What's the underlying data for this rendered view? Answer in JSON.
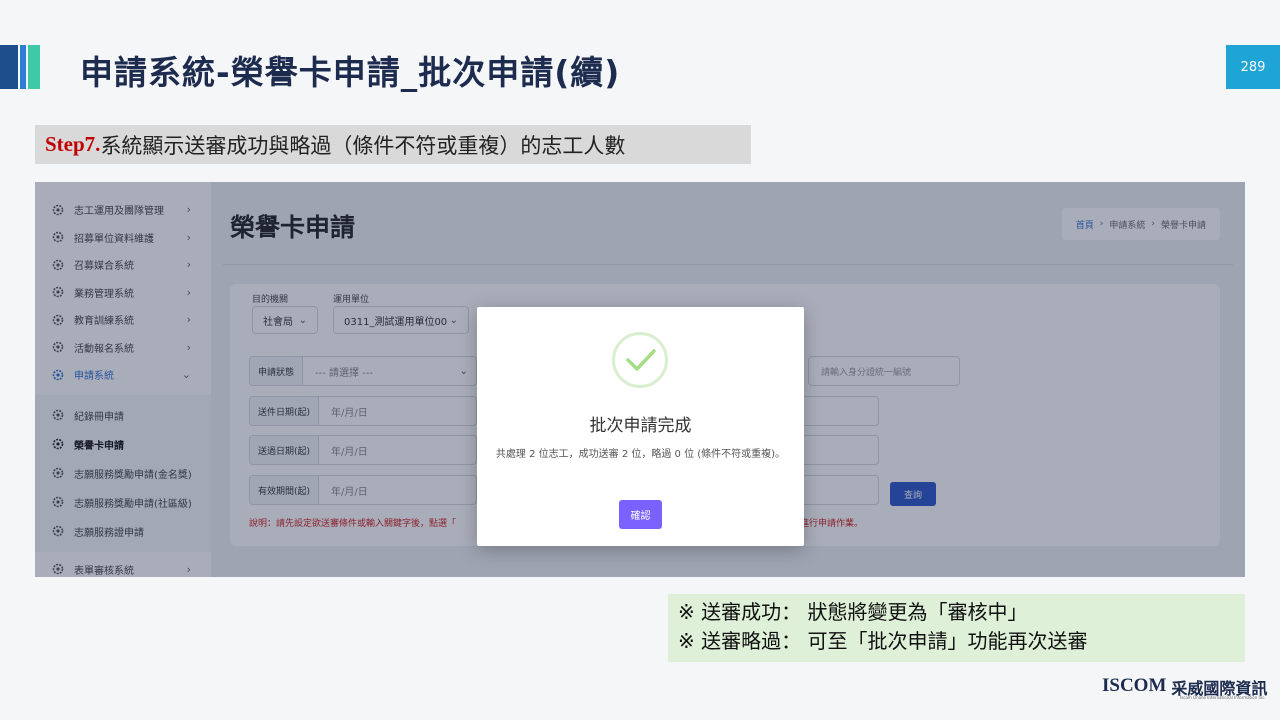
{
  "slide": {
    "title": "申請系統-榮譽卡申請_批次申請(續)",
    "page_number": "289",
    "step_label": "Step7.",
    "step_text": "系統顯示送審成功與略過（條件不符或重複）的志工人數"
  },
  "sidebar": {
    "items": [
      {
        "label": "志工運用及團隊管理",
        "chevron": "›"
      },
      {
        "label": "招募單位資料維護",
        "chevron": "›"
      },
      {
        "label": "召募媒合系統",
        "chevron": "›"
      },
      {
        "label": "業務管理系統",
        "chevron": "›"
      },
      {
        "label": "教育訓練系統",
        "chevron": "›"
      },
      {
        "label": "活動報名系統",
        "chevron": "›"
      },
      {
        "label": "申請系統",
        "chevron": "⌄"
      }
    ],
    "sub_items": [
      {
        "label": "紀錄冊申請"
      },
      {
        "label": "榮譽卡申請"
      },
      {
        "label": "志願服務獎勵申請(金名獎)"
      },
      {
        "label": "志願服務獎勵申請(社區級)"
      },
      {
        "label": "志願服務證申請"
      }
    ],
    "bottom_item": {
      "label": "表單審核系統",
      "chevron": "›"
    }
  },
  "main": {
    "page_title": "榮譽卡申請",
    "breadcrumb": {
      "home": "首頁",
      "sep1": "›",
      "mid": "申請系統",
      "sep2": "›",
      "current": "榮譽卡申請"
    },
    "filters": {
      "category_label": "目的機關",
      "category_value": "社會局",
      "unit_label": "運用單位",
      "unit_value": "0311_測試運用單位00",
      "status_label": "申請狀態",
      "status_value": "--- 請選擇 ---",
      "id_placeholder": "請輸入身分證統一編號",
      "date1_label": "送件日期(起)",
      "date2_label": "送過日期(起)",
      "date3_label": "有效期間(起)",
      "date_placeholder": "年/月/日",
      "query_button": "查詢",
      "note_left": "說明：請先設定欲送審條件或輸入關鍵字後，點選「",
      "note_right": "進行申請作業。"
    }
  },
  "modal": {
    "title": "批次申請完成",
    "message": "共處理 2 位志工，成功送審 2 位，略過 0 位 (條件不符或重複)。",
    "confirm_button": "確認"
  },
  "footnote": {
    "line1": "※ 送審成功： 狀態將變更為「審核中」",
    "line2": "※ 送審略過： 可至「批次申請」功能再次送審"
  },
  "logo": {
    "name": "ISCOM",
    "chinese": "采威國際資訊",
    "subtitle": "Iscom Online International Information Inc."
  }
}
